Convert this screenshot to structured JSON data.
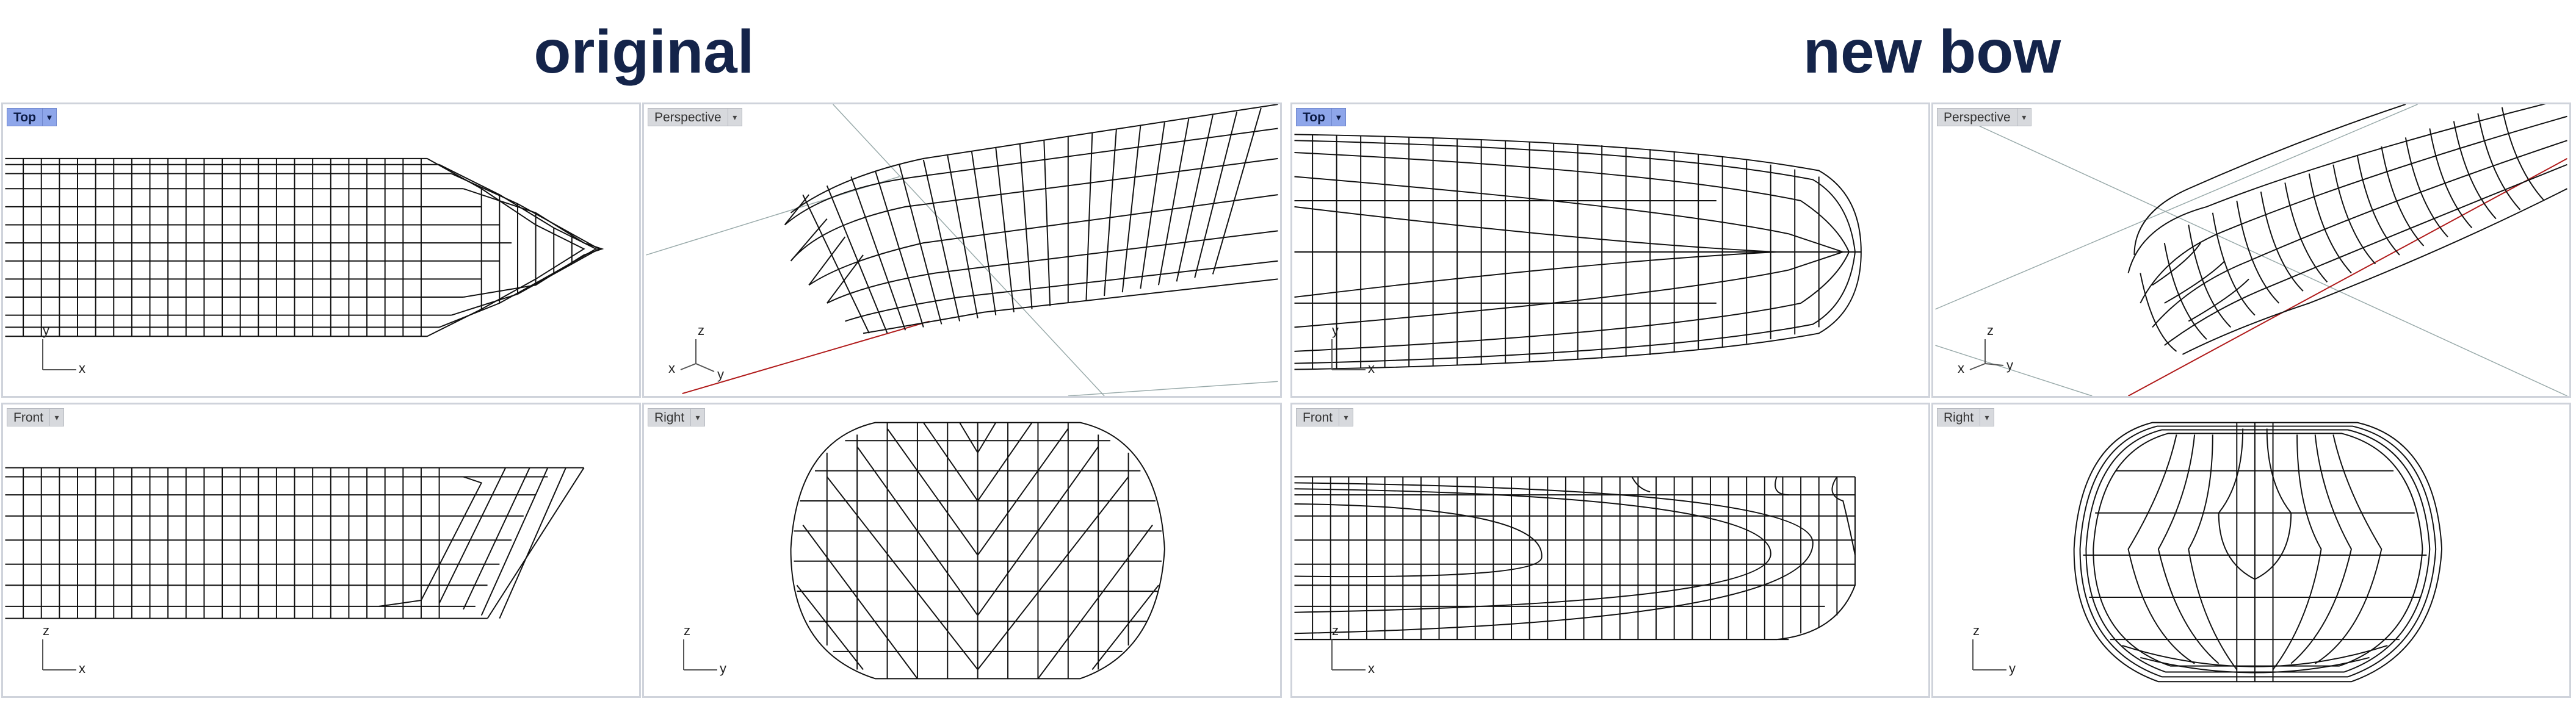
{
  "titles": {
    "left": "original",
    "right": "new bow"
  },
  "viewports": [
    {
      "id": "orig-top",
      "label": "Top",
      "active": true,
      "axes": [
        "y",
        "x"
      ]
    },
    {
      "id": "orig-persp",
      "label": "Perspective",
      "active": false,
      "axes": [
        "z",
        "x",
        "y"
      ]
    },
    {
      "id": "orig-front",
      "label": "Front",
      "active": false,
      "axes": [
        "z",
        "x"
      ]
    },
    {
      "id": "orig-right",
      "label": "Right",
      "active": false,
      "axes": [
        "z",
        "y"
      ]
    },
    {
      "id": "new-top",
      "label": "Top",
      "active": true,
      "axes": [
        "y",
        "x"
      ]
    },
    {
      "id": "new-persp",
      "label": "Perspective",
      "active": false,
      "axes": [
        "z",
        "x",
        "y"
      ]
    },
    {
      "id": "new-front",
      "label": "Front",
      "active": false,
      "axes": [
        "z",
        "x"
      ]
    },
    {
      "id": "new-right",
      "label": "Right",
      "active": false,
      "axes": [
        "z",
        "y"
      ]
    }
  ],
  "icons": {
    "viewport_menu": "dropdown-arrow-icon",
    "axes": "axis-triad-icon"
  },
  "colors": {
    "title": "#14244a",
    "active_tab": "#8ea6ea",
    "tab": "#d7d9dd",
    "axis_line": "#b01a1a"
  }
}
